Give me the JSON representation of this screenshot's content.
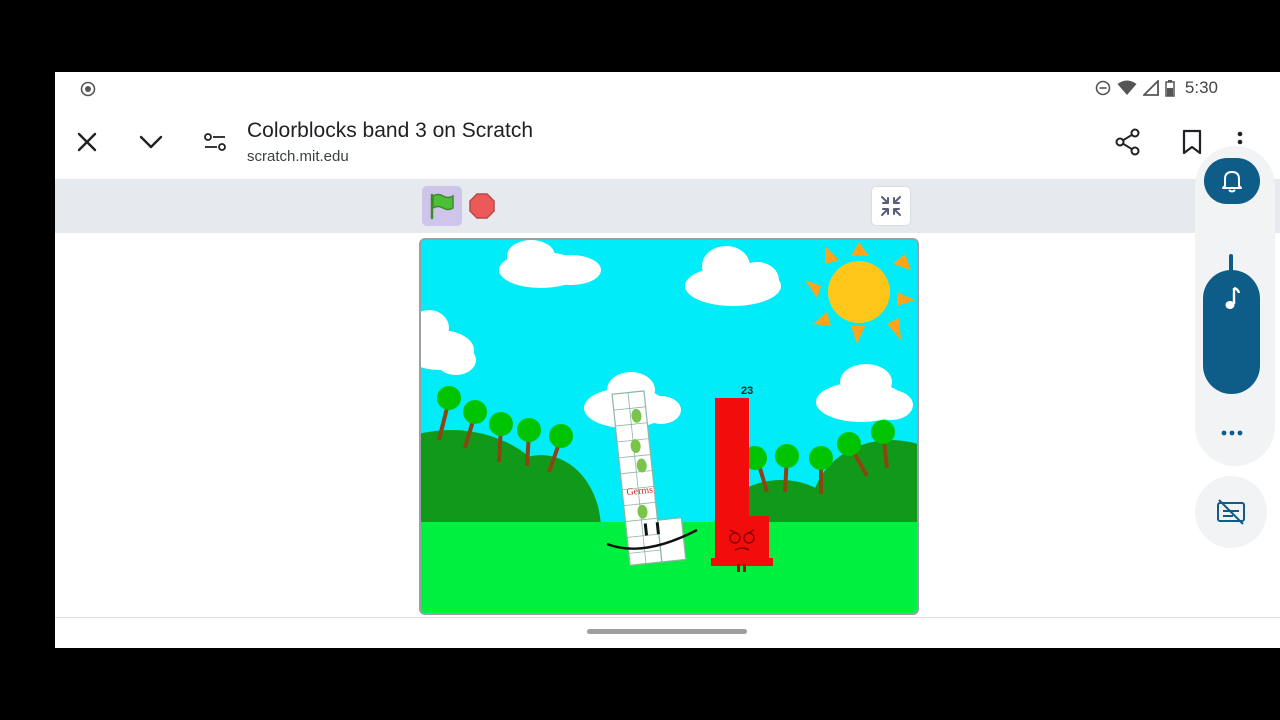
{
  "status_bar": {
    "time": "5:30",
    "icons": [
      "screen-record-icon",
      "do-not-disturb-icon",
      "wifi-icon",
      "signal-icon",
      "battery-icon"
    ]
  },
  "header": {
    "title": "Colorblocks band 3 on Scratch",
    "url": "scratch.mit.edu",
    "icons": [
      "close-icon",
      "chevron-down-icon",
      "page-settings-icon",
      "share-icon",
      "bookmark-icon",
      "more-vert-icon"
    ]
  },
  "toolbar": {
    "icons": [
      "green-flag-icon",
      "stop-icon",
      "exit-fullscreen-icon"
    ]
  },
  "stage": {
    "number_label": "23",
    "character_label": "Germs"
  },
  "side_panel": {
    "icons": [
      "bell-icon",
      "music-note-icon",
      "more-horiz-icon",
      "caption-off-icon"
    ]
  },
  "colors": {
    "sky": "#00ecf8",
    "grass": "#00f040",
    "hill": "#119a1a",
    "sun": "#ffc61a",
    "red_block": "#f20c0c",
    "panel_accent": "#0e5c88",
    "flag_bg": "#cfc4ea"
  }
}
